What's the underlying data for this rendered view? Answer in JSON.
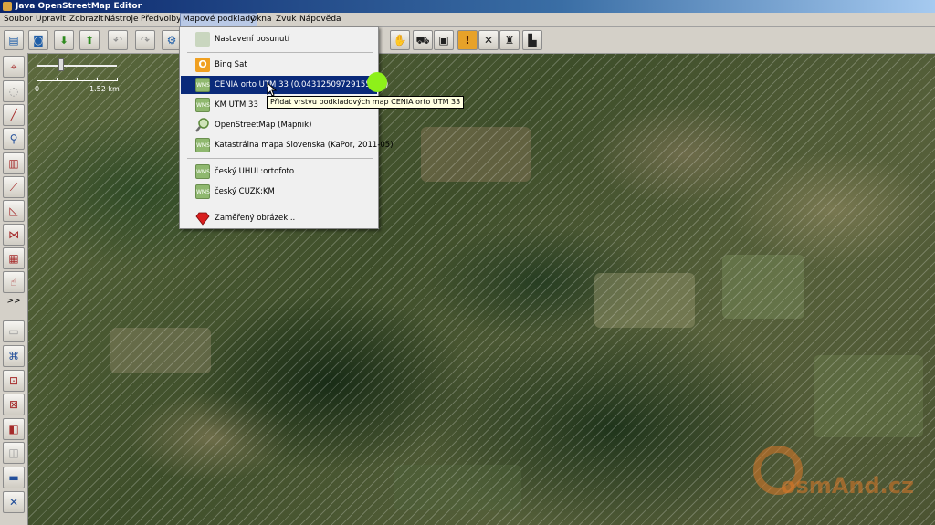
{
  "window": {
    "title": "Java OpenStreetMap Editor"
  },
  "menubar": {
    "items": [
      {
        "label": "Soubor"
      },
      {
        "label": "Upravit"
      },
      {
        "label": "Zobrazit"
      },
      {
        "label": "Nástroje"
      },
      {
        "label": "Předvolby"
      },
      {
        "label": "Mapové podklady",
        "active": true
      },
      {
        "label": "Okna"
      },
      {
        "label": "Zvuk"
      },
      {
        "label": "Nápověda"
      }
    ]
  },
  "toolbar": {
    "icons": [
      "open-file-icon",
      "save-icon",
      "download-icon",
      "upload-icon",
      "undo-icon",
      "redo-icon",
      "preferences-icon",
      "pan-hand-icon",
      "car-icon",
      "bus-icon",
      "warning-icon",
      "cross-icon",
      "building-icon",
      "industry-icon"
    ]
  },
  "left_tools": {
    "icons": [
      "select-tool-icon",
      "lasso-tool-icon",
      "draw-tool-icon",
      "zoom-tool-icon",
      "delete-tool-icon",
      "split-way-icon",
      "align-triangle-icon",
      "combine-way-icon",
      "building-tool-icon",
      "improve-way-icon",
      "layers-toggle-icon",
      "tags-toggle-icon",
      "relations-toggle-icon",
      "selection-list-icon",
      "authors-icon",
      "history-icon",
      "conflict-icon",
      "validation-icon"
    ],
    "more_label": ">>"
  },
  "scale": {
    "start": "0",
    "end": "1.52 km"
  },
  "imagery_menu": {
    "items": [
      {
        "label": "Nastavení posunutí",
        "icon": "offset-settings-icon"
      },
      {
        "label": "Bing Sat",
        "icon": "bing-icon"
      },
      {
        "label": "CENIA orto UTM 33 (0.04312509729155554)",
        "icon": "wms-icon",
        "selected": true
      },
      {
        "label": "KM UTM 33",
        "icon": "wms-icon"
      },
      {
        "label": "OpenStreetMap (Mapnik)",
        "icon": "magnifier-icon"
      },
      {
        "label": "Katastrálna mapa Slovenska (KaPor, 2011-05)",
        "icon": "wms-icon"
      },
      {
        "label": "český UHUL:ortofoto",
        "icon": "wms-icon"
      },
      {
        "label": "český CUZK:KM",
        "icon": "wms-icon"
      },
      {
        "label": "Zaměřený obrázek...",
        "icon": "red-diamond-icon"
      }
    ],
    "tooltip": "Přidat vrstvu podkladových map CENIA orto UTM 33"
  },
  "watermark": {
    "text": "osmAnd.cz"
  },
  "colors": {
    "menu_selected": "#0a2a7a",
    "tooltip_bg": "#ffffe1",
    "highlight_dot": "#8ef01a"
  }
}
